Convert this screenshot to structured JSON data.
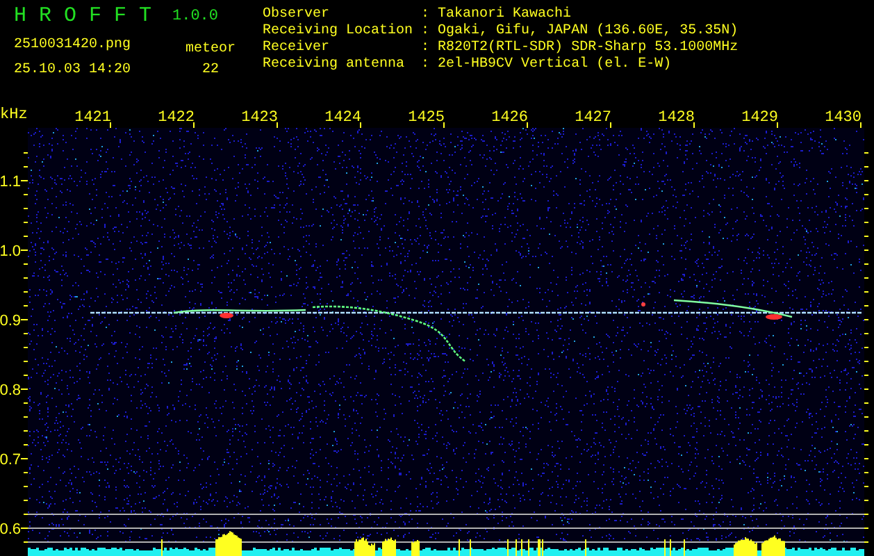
{
  "header": {
    "app_name": "H R O F F T",
    "version": "1.0.0",
    "file_name": "2510031420.png",
    "timestamp": "25.10.03 14:20",
    "meteor_label": "meteor",
    "meteor_count": "22"
  },
  "station_info": [
    {
      "label": "Observer",
      "separator": ":",
      "value": "Takanori Kawachi"
    },
    {
      "label": "Receiving Location",
      "separator": ":",
      "value": "Ogaki, Gifu, JAPAN (136.60E, 35.35N)"
    },
    {
      "label": "Receiver",
      "separator": ":",
      "value": "R820T2(RTL-SDR) SDR-Sharp 53.1000MHz"
    },
    {
      "label": "Receiving antenna",
      "separator": ":",
      "value": "2el-HB9CV Vertical (el. E-W)"
    }
  ],
  "spectrogram": {
    "y_unit": "kHz",
    "x_ticks": [
      "1421",
      "1422",
      "1423",
      "1424",
      "1425",
      "1426",
      "1427",
      "1428",
      "1429",
      "1430"
    ],
    "y_ticks": [
      "1.1",
      "1.0",
      "0.9",
      "0.8",
      "0.7",
      "0.6"
    ]
  }
}
